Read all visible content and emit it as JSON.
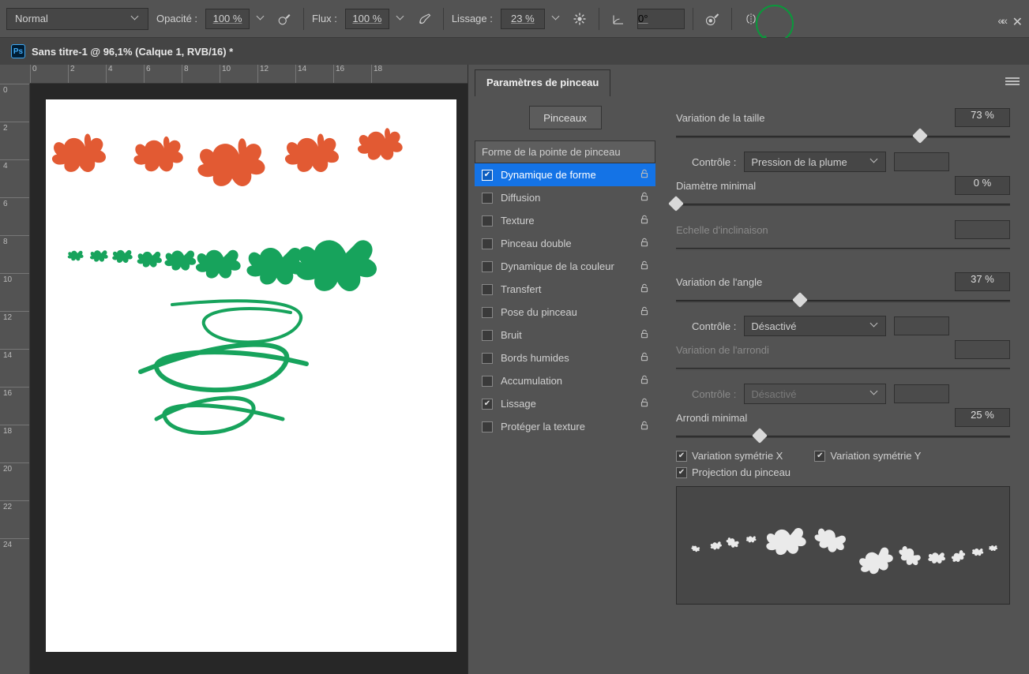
{
  "options": {
    "blend_mode": "Normal",
    "opacity_label": "Opacité :",
    "opacity_value": "100 %",
    "flow_label": "Flux :",
    "flow_value": "100 %",
    "smoothing_label": "Lissage :",
    "smoothing_value": "23 %",
    "angle_value": "0°"
  },
  "document": {
    "title": "Sans titre-1 @ 96,1% (Calque 1, RVB/16) *"
  },
  "ruler_h": [
    "0",
    "2",
    "4",
    "6",
    "8",
    "10",
    "12",
    "14",
    "16",
    "18"
  ],
  "ruler_v": [
    "0",
    "2",
    "4",
    "6",
    "8",
    "10",
    "12",
    "14",
    "16",
    "18",
    "20",
    "22",
    "24"
  ],
  "panel": {
    "title": "Paramètres de pinceau",
    "brushes_button": "Pinceaux",
    "settings": [
      {
        "label": "Forme de la pointe de pinceau",
        "header": true
      },
      {
        "label": "Dynamique de forme",
        "checked": true,
        "selected": true,
        "lock": true
      },
      {
        "label": "Diffusion",
        "checked": false,
        "lock": true
      },
      {
        "label": "Texture",
        "checked": false,
        "lock": true
      },
      {
        "label": "Pinceau double",
        "checked": false,
        "lock": true
      },
      {
        "label": "Dynamique de la couleur",
        "checked": false,
        "lock": true
      },
      {
        "label": "Transfert",
        "checked": false,
        "lock": true
      },
      {
        "label": "Pose du pinceau",
        "checked": false,
        "lock": true
      },
      {
        "label": "Bruit",
        "checked": false,
        "lock": true
      },
      {
        "label": "Bords humides",
        "checked": false,
        "lock": true
      },
      {
        "label": "Accumulation",
        "checked": false,
        "lock": true
      },
      {
        "label": "Lissage",
        "checked": true,
        "lock": true
      },
      {
        "label": "Protéger la texture",
        "checked": false,
        "lock": true
      }
    ],
    "size_jitter_label": "Variation de la taille",
    "size_jitter_value": "73 %",
    "size_jitter_pct": 73,
    "control_label": "Contrôle :",
    "size_control_value": "Pression de la plume",
    "min_diam_label": "Diamètre minimal",
    "min_diam_value": "0 %",
    "min_diam_pct": 0,
    "tilt_label": "Echelle d'inclinaison",
    "angle_jitter_label": "Variation de l'angle",
    "angle_jitter_value": "37 %",
    "angle_jitter_pct": 37,
    "angle_control_value": "Désactivé",
    "round_jitter_label": "Variation de l'arrondi",
    "round_control_value": "Désactivé",
    "min_round_label": "Arrondi minimal",
    "min_round_value": "25 %",
    "min_round_pct": 25,
    "flipx_label": "Variation symétrie X",
    "flipy_label": "Variation symétrie Y",
    "projection_label": "Projection du pinceau"
  }
}
